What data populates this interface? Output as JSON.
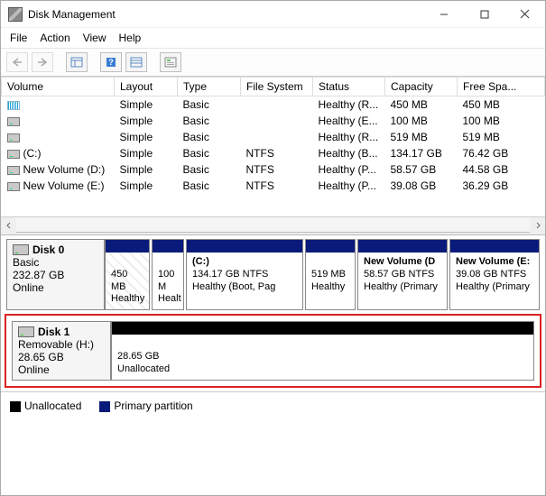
{
  "window": {
    "title": "Disk Management"
  },
  "menu": {
    "file": "File",
    "action": "Action",
    "view": "View",
    "help": "Help"
  },
  "columns": {
    "volume": "Volume",
    "layout": "Layout",
    "type": "Type",
    "fs": "File System",
    "status": "Status",
    "capacity": "Capacity",
    "free": "Free Spa..."
  },
  "volumes": [
    {
      "name": "",
      "iconClass": "recov",
      "layout": "Simple",
      "type": "Basic",
      "fs": "",
      "status": "Healthy (R...",
      "capacity": "450 MB",
      "free": "450 MB"
    },
    {
      "name": "",
      "iconClass": "drive",
      "layout": "Simple",
      "type": "Basic",
      "fs": "",
      "status": "Healthy (E...",
      "capacity": "100 MB",
      "free": "100 MB"
    },
    {
      "name": "",
      "iconClass": "drive",
      "layout": "Simple",
      "type": "Basic",
      "fs": "",
      "status": "Healthy (R...",
      "capacity": "519 MB",
      "free": "519 MB"
    },
    {
      "name": "(C:)",
      "iconClass": "drive",
      "layout": "Simple",
      "type": "Basic",
      "fs": "NTFS",
      "status": "Healthy (B...",
      "capacity": "134.17 GB",
      "free": "76.42 GB"
    },
    {
      "name": "New Volume (D:)",
      "iconClass": "drive",
      "layout": "Simple",
      "type": "Basic",
      "fs": "NTFS",
      "status": "Healthy (P...",
      "capacity": "58.57 GB",
      "free": "44.58 GB"
    },
    {
      "name": "New Volume (E:)",
      "iconClass": "drive",
      "layout": "Simple",
      "type": "Basic",
      "fs": "NTFS",
      "status": "Healthy (P...",
      "capacity": "39.08 GB",
      "free": "36.29 GB"
    }
  ],
  "disk0": {
    "name": "Disk 0",
    "type": "Basic",
    "size": "232.87 GB",
    "state": "Online",
    "parts": [
      {
        "title": "",
        "line1": "450 MB",
        "line2": "Healthy"
      },
      {
        "title": "",
        "line1": "100 M",
        "line2": "Healt"
      },
      {
        "title": "(C:)",
        "line1": "134.17 GB NTFS",
        "line2": "Healthy (Boot, Pag"
      },
      {
        "title": "",
        "line1": "519 MB",
        "line2": "Healthy"
      },
      {
        "title": "New Volume  (D",
        "line1": "58.57 GB NTFS",
        "line2": "Healthy (Primary"
      },
      {
        "title": "New Volume  (E:",
        "line1": "39.08 GB NTFS",
        "line2": "Healthy (Primary"
      }
    ]
  },
  "disk1": {
    "name": "Disk 1",
    "type": "Removable (H:)",
    "size": "28.65 GB",
    "state": "Online",
    "part": {
      "line1": "28.65 GB",
      "line2": "Unallocated"
    }
  },
  "legend": {
    "unallocated": "Unallocated",
    "primary": "Primary partition"
  }
}
